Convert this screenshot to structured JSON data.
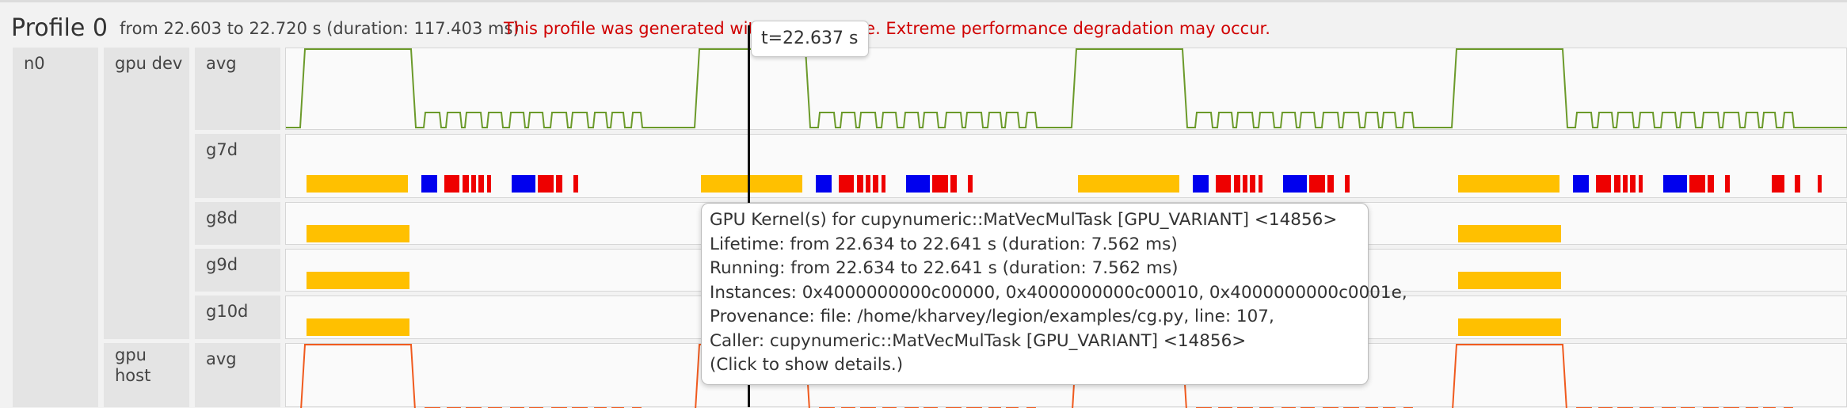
{
  "header": {
    "title": "Profile 0",
    "range": "from 22.603 to 22.720 s (duration: 117.403 ms)",
    "warning": "This profile was generated with debug mode. Extreme performance degradation may occur."
  },
  "nodes": [
    {
      "name": "n0",
      "groups": [
        {
          "name": "gpu dev",
          "tracks": [
            "avg",
            "g7d",
            "g8d",
            "g9d",
            "g10d"
          ]
        },
        {
          "name_lines": [
            "gpu",
            "host"
          ],
          "tracks": [
            "avg"
          ]
        }
      ]
    }
  ],
  "cursor": {
    "label": "t=22.637 s"
  },
  "tooltip": {
    "lines": [
      "GPU Kernel(s) for cupynumeric::MatVecMulTask [GPU_VARIANT] <14856>",
      "Lifetime: from 22.634 to 22.641 s (duration: 7.562 ms)",
      "Running: from 22.634 to 22.641 s (duration: 7.562 ms)",
      "Instances: 0x4000000000c00000, 0x4000000000c00010, 0x4000000000c0001e,",
      "Provenance: file: /home/kharvey/legion/examples/cg.py, line: 107,",
      "Caller: cupynumeric::MatVecMulTask [GPU_VARIANT] <14856>",
      "(Click to show details.)"
    ]
  },
  "colors": {
    "gpu_dev_avg_line": "#6b9a2a",
    "gpu_host_avg_line": "#f05a1e",
    "kernel_yellow": "#ffc000",
    "kernel_blue": "#0000ee",
    "kernel_red": "#ee0000",
    "warning_text": "#d00000"
  }
}
